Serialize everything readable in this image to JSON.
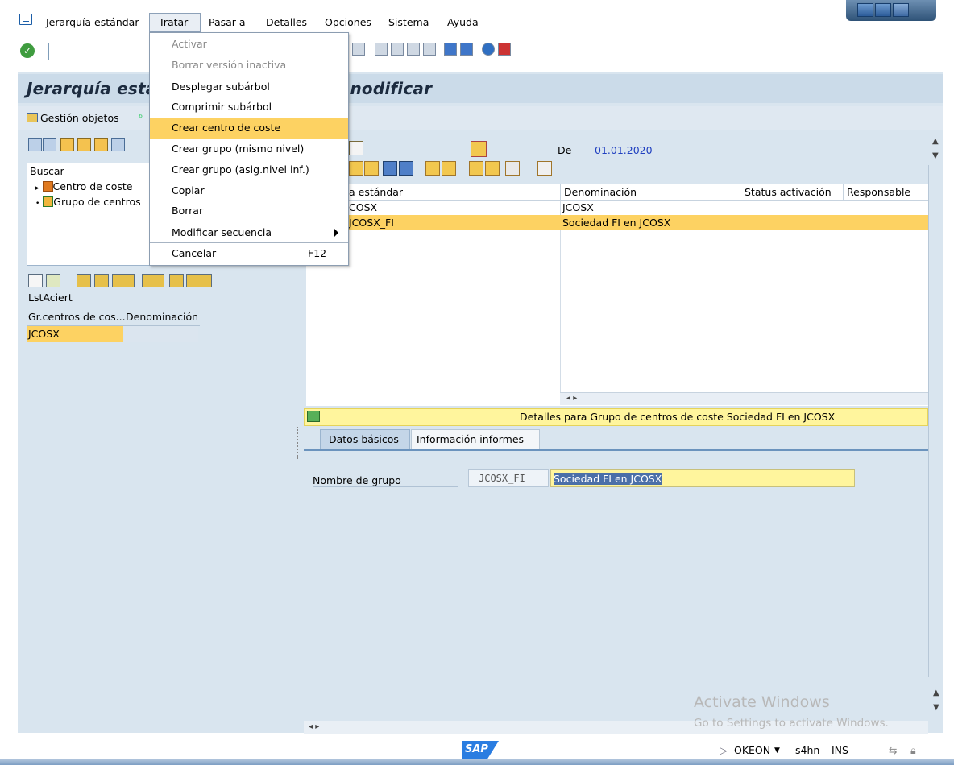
{
  "menubar": {
    "items": [
      "Jerarquía estándar",
      "Tratar",
      "Pasar a",
      "Detalles",
      "Opciones",
      "Sistema",
      "Ayuda"
    ]
  },
  "title": "Jerarquía está",
  "title_suffix": "nodificar",
  "app_toolbar": {
    "gestion_objetos": "Gestión objetos"
  },
  "left": {
    "buscar": "Buscar",
    "tree": [
      "Centro de coste",
      "Grupo de centros"
    ],
    "list_title": "LstAciert",
    "list_headers": [
      "Gr.centros de cos...",
      "Denominación"
    ],
    "list_rows": [
      [
        "JCOSX",
        ""
      ]
    ]
  },
  "right": {
    "de_label": "De",
    "de_value": "01.01.2020",
    "headers": [
      "a estándar",
      "Denominación",
      "Status activación",
      "Responsable"
    ],
    "rows": [
      {
        "code": "COSX",
        "name": "JCOSX"
      },
      {
        "code": "JCOSX_FI",
        "name": "Sociedad FI en JCOSX"
      }
    ]
  },
  "details": {
    "title": "Detalles para Grupo de centros de coste Sociedad FI en JCOSX",
    "tabs": [
      "Datos básicos",
      "Información informes"
    ],
    "nombre_label": "Nombre de grupo",
    "nombre_code": "JCOSX_FI",
    "nombre_text": "Sociedad FI en JCOSX"
  },
  "dropdown": {
    "items": [
      {
        "label": "Activar",
        "disabled": true
      },
      {
        "label": "Borrar versión inactiva",
        "disabled": true
      },
      {
        "label": "Desplegar subárbol"
      },
      {
        "label": "Comprimir subárbol"
      },
      {
        "label": "Crear centro de coste",
        "highlighted": true
      },
      {
        "label": "Crear grupo (mismo nivel)"
      },
      {
        "label": "Crear grupo (asig.nivel inf.)"
      },
      {
        "label": "Copiar"
      },
      {
        "label": "Borrar"
      },
      {
        "label": "Modificar secuencia"
      },
      {
        "label": "Cancelar",
        "shortcut": "F12"
      }
    ]
  },
  "status": {
    "system": "OKEON",
    "client": "s4hn",
    "mode": "INS",
    "logo": "SAP"
  },
  "watermark": {
    "line1": "Activate Windows",
    "line2": "Go to Settings to activate Windows."
  },
  "colors": {
    "highlight": "#fdd262",
    "title_bg": "#cbdbe9",
    "pane_bg": "#d9e5ef",
    "details_bar": "#fff59d"
  }
}
